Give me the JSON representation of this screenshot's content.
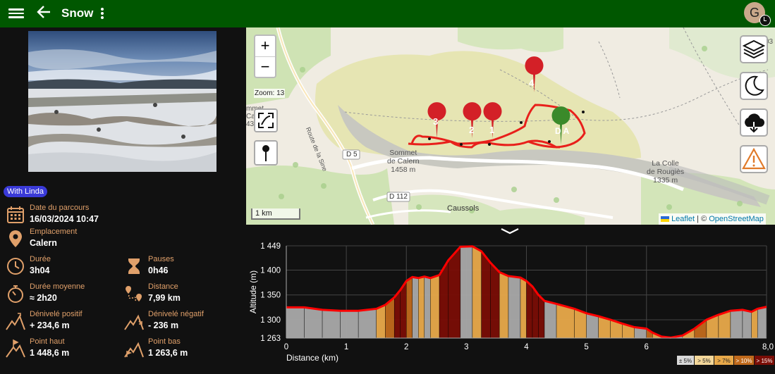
{
  "app": {
    "title": "Snow",
    "avatar_letter": "G"
  },
  "activity": {
    "tag": "With Linda",
    "stats": [
      {
        "key": "date",
        "label": "Date du parcours",
        "value": "16/03/2024 10:47"
      },
      {
        "key": "location",
        "label": "Emplacement",
        "value": "Calern"
      },
      {
        "key": "duration",
        "label": "Durée",
        "value": "3h04"
      },
      {
        "key": "pauses",
        "label": "Pauses",
        "value": "0h46"
      },
      {
        "key": "avg_duration",
        "label": "Durée moyenne",
        "value": "≈ 2h20"
      },
      {
        "key": "distance",
        "label": "Distance",
        "value": "7,99 km"
      },
      {
        "key": "elev_gain",
        "label": "Dénivelé positif",
        "value": "+ 234,6 m"
      },
      {
        "key": "elev_loss",
        "label": "Dénivelé négatif",
        "value": "- 236 m"
      },
      {
        "key": "high",
        "label": "Point haut",
        "value": "1 448,6 m"
      },
      {
        "key": "low",
        "label": "Point bas",
        "value": "1 263,6 m"
      }
    ]
  },
  "map": {
    "zoom_in": "+",
    "zoom_out": "−",
    "zoom_label": "Zoom: 13",
    "scale": "1 km",
    "attribution_leaflet": "Leaflet",
    "attribution_sep": " | © ",
    "attribution_osm": "OpenStreetMap",
    "place_labels": [
      {
        "id": "sommet-calern",
        "lines": [
          "Sommet",
          "de Calern",
          "1458 m"
        ]
      },
      {
        "id": "colle-rougies",
        "lines": [
          "La Colle",
          "de Rougiès",
          "1335 m"
        ]
      },
      {
        "id": "caussols",
        "lines": [
          "Caussols"
        ]
      },
      {
        "id": "route-sine",
        "lines": [
          "Route de la Sine"
        ]
      },
      {
        "id": "d5",
        "lines": [
          "D 5"
        ]
      },
      {
        "id": "d112",
        "lines": [
          "D 112"
        ]
      },
      {
        "id": "sommet-left",
        "lines": [
          "mmet",
          "Ca",
          "43"
        ]
      },
      {
        "id": "right-03",
        "lines": [
          "03"
        ]
      }
    ],
    "markers": [
      "1",
      "2",
      "3",
      "4"
    ],
    "start_marker": "D A",
    "colors": {
      "track": "#e8201b",
      "marker": "#d32027",
      "start": "#3a8a2a"
    }
  },
  "chart_data": {
    "type": "area",
    "xlabel": "Distance (km)",
    "ylabel": "Altitude (m)",
    "xlim": [
      0,
      8.0
    ],
    "ylim": [
      1263,
      1449
    ],
    "x_ticks": [
      "0",
      "1",
      "2",
      "3",
      "4",
      "5",
      "6",
      "8,0"
    ],
    "x_tick_values": [
      0,
      1,
      2,
      3,
      4,
      5,
      6,
      8
    ],
    "y_ticks": [
      "1 263",
      "1 300",
      "1 350",
      "1 400",
      "1 449"
    ],
    "y_tick_values": [
      1263,
      1300,
      1350,
      1400,
      1449
    ],
    "x": [
      0,
      0.3,
      0.6,
      0.9,
      1.2,
      1.5,
      1.65,
      1.8,
      1.9,
      2.0,
      2.1,
      2.2,
      2.3,
      2.4,
      2.55,
      2.7,
      2.9,
      3.1,
      3.25,
      3.4,
      3.55,
      3.7,
      3.9,
      4.0,
      4.1,
      4.2,
      4.3,
      4.5,
      4.8,
      5.0,
      5.2,
      5.4,
      5.6,
      5.8,
      6.0,
      6.1,
      6.25,
      6.4,
      6.6,
      6.8,
      7.0,
      7.2,
      7.4,
      7.6,
      7.75,
      7.85,
      8.0
    ],
    "y": [
      1325,
      1325,
      1320,
      1318,
      1318,
      1322,
      1330,
      1345,
      1360,
      1378,
      1386,
      1384,
      1387,
      1384,
      1390,
      1420,
      1447,
      1448,
      1438,
      1415,
      1396,
      1388,
      1385,
      1378,
      1367,
      1350,
      1338,
      1332,
      1322,
      1313,
      1307,
      1300,
      1292,
      1285,
      1282,
      1274,
      1266,
      1264,
      1268,
      1282,
      1300,
      1310,
      1318,
      1320,
      1316,
      1322,
      1326
    ],
    "legend": [
      "± 5%",
      "> 5%",
      "> 7%",
      "> 10%",
      "> 15%"
    ],
    "legend_colors": [
      "#d9d9d9",
      "#f3d79a",
      "#e8a94a",
      "#c06a1c",
      "#7a0d06"
    ],
    "line_color": "#ff0000"
  }
}
